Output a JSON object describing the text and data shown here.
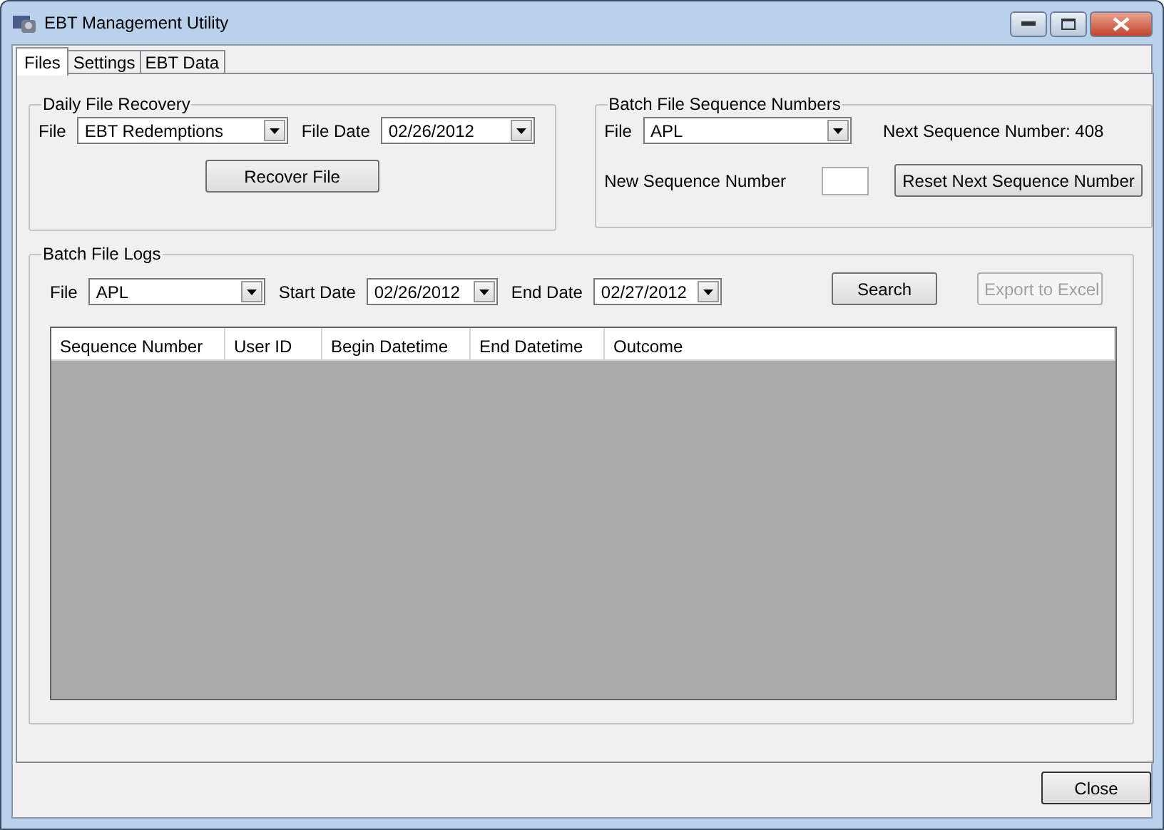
{
  "window": {
    "title": "EBT Management Utility"
  },
  "tabs": [
    {
      "label": "Files",
      "selected": true
    },
    {
      "label": "Settings",
      "selected": false
    },
    {
      "label": "EBT Data",
      "selected": false
    }
  ],
  "daily_file_recovery": {
    "title": "Daily File Recovery",
    "file_label": "File",
    "file_value": "EBT Redemptions",
    "date_label": "File Date",
    "date_value": "02/26/2012",
    "button": "Recover File"
  },
  "batch_file_sequence_numbers": {
    "title": "Batch File Sequence Numbers",
    "file_label": "File",
    "file_value": "APL",
    "next_sequence": "Next Sequence Number: 408",
    "new_label": "New Sequence Number",
    "button": "Reset Next Sequence Number"
  },
  "batch_file_logs": {
    "title": "Batch File Logs",
    "file_label": "File",
    "file_value": "APL",
    "start_label": "Start Date",
    "start_value": "02/26/2012",
    "end_label": "End Date",
    "end_value": "02/27/2012",
    "buttons": [
      {
        "label": "Search",
        "disabled": false
      },
      {
        "label": "Export to Excel",
        "disabled": true
      }
    ],
    "table": {
      "columns": [
        "Sequence Number",
        "User ID",
        "Begin Datetime",
        "End Datetime",
        "Outcome"
      ]
    }
  },
  "buttons": [
    "Close"
  ]
}
